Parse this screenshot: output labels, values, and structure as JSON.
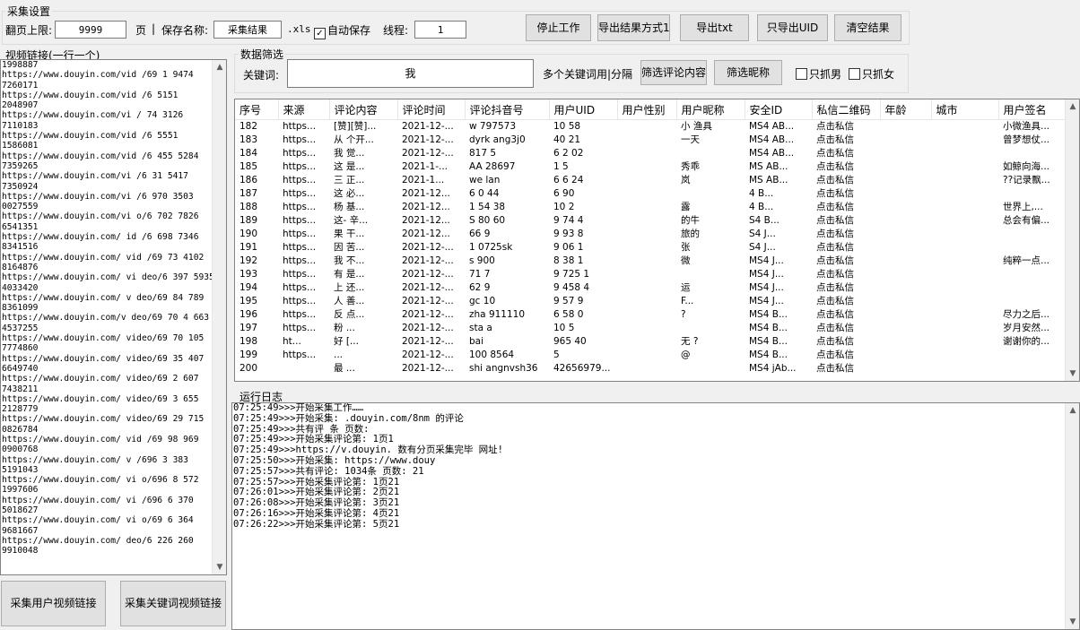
{
  "settings": {
    "title": "采集设置",
    "page_limit_label": "翻页上限:",
    "page_limit_value": "9999",
    "page_unit": "页",
    "separator": "|",
    "save_name_label": "保存名称:",
    "save_name_value": "采集结果",
    "ext": ".xls",
    "auto_save_label": "自动保存",
    "auto_save_checked": true,
    "thread_label": "线程:",
    "thread_value": "1",
    "buttons": {
      "stop": "停止工作",
      "export_mode": "导出结果方式1",
      "export_txt": "导出txt",
      "export_uid": "只导出UID",
      "clear": "清空结果"
    }
  },
  "links": {
    "title": "视频链接(一行一个)",
    "lines": [
      "1998887",
      "https://www.douyin.com/vid   /69  1   9474",
      "7260171",
      "https://www.douyin.com/vid   /6    5151",
      "2048907",
      "https://www.douyin.com/vi   /    74  3126",
      "7110183",
      "https://www.douyin.com/vid    /6    5551",
      "1586081",
      "https://www.douyin.com/vid    /6   455  5284",
      "7359265",
      "https://www.douyin.com/vi     /6   31   5417",
      "7350924",
      "https://www.douyin.com/vi   /6   970   3503",
      "0027559",
      "https://www.douyin.com/vi   o/6  702    7826",
      "6541351",
      "https://www.douyin.com/ id   /6  698   7346",
      "8341516",
      "https://www.douyin.com/ vid   /69 73   4102",
      "8164876",
      "https://www.douyin.com/ vi   deo/6 397   5935",
      "4033420",
      "https://www.douyin.com/ v   deo/69  84   789",
      "8361099",
      "https://www.douyin.com/v   deo/69 70   4  663",
      "4537255",
      "https://www.douyin.com/   video/69    70  105",
      "7774860",
      "https://www.douyin.com/   video/69   35   407",
      "6649740",
      "https://www.douyin.com/   video/69   2   607",
      "7438211",
      "https://www.douyin.com/   video/69   3   655",
      "2128779",
      "https://www.douyin.com/   video/69   29   715",
      "0826784",
      "https://www.douyin.com/   vid   /69   98   969",
      "0900768",
      "https://www.douyin.com/   v   /696  3   383",
      "5191043",
      "https://www.douyin.com/   vi   o/696  8  572",
      "1997606",
      "https://www.douyin.com/   vi   /696   6   370",
      "5018627",
      "https://www.douyin.com/   vi   o/69   6   364",
      "9681667",
      "https://www.douyin.com/   deo/6  226   260",
      "9910048"
    ],
    "buttons": {
      "user_links": "采集用户视频链接",
      "keyword_links": "采集关键词视频链接"
    }
  },
  "filter": {
    "title": "数据筛选",
    "keyword_label": "关键词:",
    "keyword_value": "我",
    "hint": "多个关键词用|分隔",
    "filter_comment_btn": "筛选评论内容",
    "filter_nick_btn": "筛选昵称",
    "only_male": "只抓男",
    "only_female": "只抓女"
  },
  "table": {
    "headers": [
      "序号",
      "来源",
      "评论内容",
      "评论时间",
      "评论抖音号",
      "用户UID",
      "用户性别",
      "用户昵称",
      "安全ID",
      "私信二维码",
      "年龄",
      "城市",
      "用户签名"
    ],
    "rows": [
      [
        "182",
        "https...",
        "[赞][赞]...",
        "2021-12-...",
        "w   797573",
        "10  58",
        "",
        "小  渔具",
        "MS4  AB...",
        "点击私信",
        "",
        "",
        "小微渔具..."
      ],
      [
        "183",
        "https...",
        "从  个开...",
        "2021-12-...",
        "dyrk  ang3j0",
        "40  21",
        "",
        "  一天",
        "MS4  AB...",
        "点击私信",
        "",
        "",
        "曾梦想仗..."
      ],
      [
        "184",
        "https...",
        "我  觉...",
        "2021-12-...",
        "817  5",
        "6   2  02",
        "",
        "",
        "MS4  AB...",
        "点击私信",
        "",
        "",
        ""
      ],
      [
        "185",
        "https...",
        "这  是...",
        "2021-1-...",
        "AA   28697",
        "1   5",
        "",
        "   秀乖",
        "MS   AB...",
        "点击私信",
        "",
        "",
        "如鲸向海..."
      ],
      [
        "186",
        "https...",
        "三  正...",
        "2021-1...",
        "we   lan",
        "6  6   24",
        "",
        "  岚",
        "MS   AB...",
        "点击私信",
        "",
        "",
        "??记录飘..."
      ],
      [
        "187",
        "https...",
        "这  必...",
        "2021-12...",
        "6  0  44",
        "6    90",
        "",
        "",
        "  4  B...",
        "点击私信",
        "",
        "",
        ""
      ],
      [
        "188",
        "https...",
        "杨  基...",
        "2021-12...",
        "1  54   38",
        "10  2",
        "",
        "  露",
        "  4  B...",
        "点击私信",
        "",
        "",
        "世界上,..."
      ],
      [
        "189",
        "https...",
        "这-  辛...",
        "2021-12...",
        "S  80  60",
        "9   74  4",
        "",
        "  的牛",
        "  S4  B...",
        "点击私信",
        "",
        "",
        "总会有偏..."
      ],
      [
        "190",
        "https...",
        "果  干...",
        "2021-12...",
        "  66  9",
        "9   93  8",
        "",
        "  旅的",
        "  S4  J...",
        "点击私信",
        "",
        "",
        ""
      ],
      [
        "191",
        "https...",
        "因  苦...",
        "2021-12-...",
        "  1  0725sk",
        "9   06  1",
        "",
        "  张",
        "  S4  J...",
        "点击私信",
        "",
        "",
        ""
      ],
      [
        "192",
        "https...",
        "我  不...",
        "2021-12-...",
        "s   900",
        "8   38  1",
        "",
        "  微",
        "MS4  J...",
        "点击私信",
        "",
        "",
        "纯粹一点..."
      ],
      [
        "193",
        "https...",
        "有  是...",
        "2021-12-...",
        "71  7",
        "9  725  1",
        "",
        "",
        "MS4  J...",
        "点击私信",
        "",
        "",
        ""
      ],
      [
        "194",
        "https...",
        "上  还...",
        "2021-12-...",
        "62   9",
        "9   458  4",
        "",
        "  运",
        "MS4  J...",
        "点击私信",
        "",
        "",
        ""
      ],
      [
        "195",
        "https...",
        "人  善...",
        "2021-12-...",
        "gc   10",
        "9   57  9",
        "",
        "  F...",
        "MS4  J...",
        "点击私信",
        "",
        "",
        ""
      ],
      [
        "196",
        "https...",
        "反  点...",
        "2021-12-...",
        "zha   911110",
        "6   58  0",
        "",
        "  ?",
        "MS4  B...",
        "点击私信",
        "",
        "",
        "尽力之后..."
      ],
      [
        "197",
        "https...",
        "粉  ...",
        "2021-12-...",
        "sta   a",
        "10  5",
        "",
        "",
        "MS4  B...",
        "点击私信",
        "",
        "",
        "岁月安然..."
      ],
      [
        "198",
        "ht...",
        "好  [...",
        "2021-12-...",
        "bai   ",
        "965 40",
        "",
        "无  ?",
        "MS4  B...",
        "点击私信",
        "",
        "",
        "谢谢你的..."
      ],
      [
        "199",
        "https...",
        "  ...",
        "2021-12-...",
        "100  8564",
        "  5",
        "",
        "@  ",
        "MS4  B...",
        "点击私信",
        "",
        "",
        ""
      ],
      [
        "200",
        "",
        "最  ...",
        "2021-12-...",
        "shi  angnvsh36",
        "42656979...",
        "",
        "",
        "MS4  jAb...",
        "点击私信",
        "",
        "",
        ""
      ]
    ]
  },
  "log": {
    "title": "运行日志",
    "lines": [
      "07:25:49>>>开始采集工作……",
      "07:25:49>>>开始采集:          .douyin.com/8nm                              的评论",
      "07:25:49>>>共有评    条 页数:",
      "07:25:49>>>开始采集评论第: 1页1",
      "07:25:49>>>https://v.douyin.                                    数有分页采集完毕     网址!",
      "07:25:50>>>开始采集: https://www.douy",
      "07:25:57>>>共有评论: 1034条 页数: 21",
      "07:25:57>>>开始采集评论第: 1页21",
      "07:26:01>>>开始采集评论第: 2页21",
      "07:26:08>>>开始采集评论第: 3页21",
      "07:26:16>>>开始采集评论第: 4页21",
      "07:26:22>>>开始采集评论第: 5页21"
    ]
  }
}
